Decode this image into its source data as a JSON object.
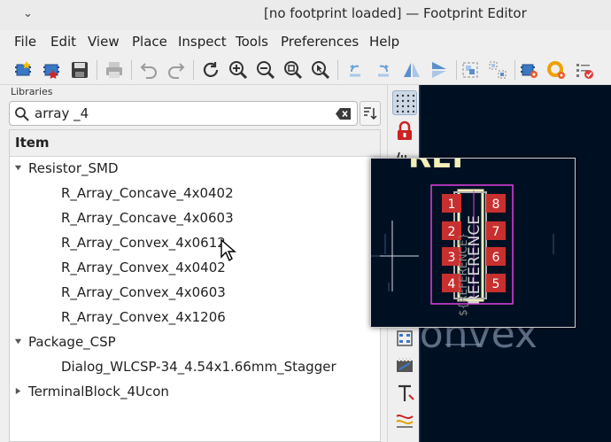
{
  "window": {
    "title": "[no footprint loaded] — Footprint Editor"
  },
  "menu": [
    "File",
    "Edit",
    "View",
    "Place",
    "Inspect",
    "Tools",
    "Preferences",
    "Help"
  ],
  "toolbar_icons": [
    "new-footprint-icon",
    "new-footprint-wizard-icon",
    "save-icon",
    "print-icon",
    "undo-icon",
    "redo-icon",
    "refresh-icon",
    "zoom-in-icon",
    "zoom-out-icon",
    "zoom-fit-icon",
    "zoom-selection-icon",
    "rotate-ccw-icon",
    "rotate-cw-icon",
    "mirror-vertical-icon",
    "mirror-horizontal-icon",
    "group-icon",
    "ungroup-icon",
    "footprint-properties-icon",
    "pad-properties-icon",
    "check-footprint-icon"
  ],
  "libraries": {
    "label": "Libraries",
    "search_value": "array _4",
    "column_header": "Item",
    "tree": [
      {
        "name": "Resistor_SMD",
        "expanded": true,
        "children": [
          "R_Array_Concave_4x0402",
          "R_Array_Concave_4x0603",
          "R_Array_Convex_4x0612",
          "R_Array_Convex_4x0402",
          "R_Array_Convex_4x0603",
          "R_Array_Convex_4x1206"
        ]
      },
      {
        "name": "Package_CSP",
        "expanded": true,
        "children": [
          "Dialog_WLCSP-34_4.54x1.66mm_Stagger"
        ]
      },
      {
        "name": "TerminalBlock_4Ucon",
        "expanded": false,
        "children": []
      }
    ]
  },
  "preview": {
    "pads_left": [
      "1",
      "2",
      "3",
      "4"
    ],
    "pads_right": [
      "8",
      "7",
      "6",
      "5"
    ],
    "reference_text": "REFERENCE",
    "value_text": "${REFERENCE}",
    "top_text": "REF",
    "canvas_text": "Convex"
  },
  "colors": {
    "canvas_bg": "#001023",
    "pad": "#c8302f",
    "courtyard": "#e040e0",
    "silk": "#f2f0b8",
    "fab": "#b0b0b0"
  }
}
